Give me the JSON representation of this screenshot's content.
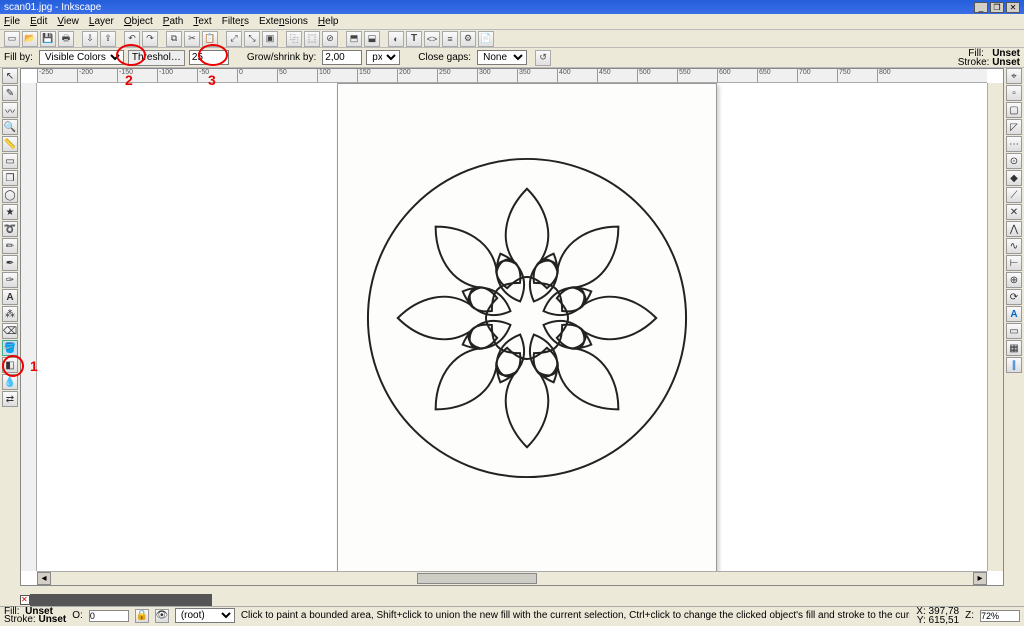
{
  "title": "scan01.jpg - Inkscape",
  "menu": {
    "file": "File",
    "edit": "Edit",
    "view": "View",
    "layer": "Layer",
    "object": "Object",
    "path": "Path",
    "text": "Text",
    "filters": "Filters",
    "extensions": "Extensions",
    "help": "Help"
  },
  "winbtns": {
    "min": "_",
    "max": "❐",
    "close": "✕"
  },
  "tooloptions": {
    "fillby_label": "Fill by:",
    "fillby_value": "Visible Colors",
    "threshold_label": "Threshol…",
    "threshold_value": "25",
    "growshrink_label": "Grow/shrink by:",
    "growshrink_value": "2,00",
    "unit": "px",
    "closegaps_label": "Close gaps:",
    "closegaps_value": "None"
  },
  "fillstroke": {
    "fill_lbl": "Fill:",
    "stroke_lbl": "Stroke:",
    "fill_val": "Unset",
    "stroke_val": "Unset"
  },
  "annotations": {
    "a1": "1",
    "a2": "2",
    "a3": "3"
  },
  "statusbar": {
    "fill_lbl": "Fill:",
    "stroke_lbl": "Stroke:",
    "fill_val": "Unset",
    "stroke_val": "Unset",
    "opacity_lbl": "O:",
    "opacity_val": "0",
    "layer": "(root)",
    "hint": "Click to paint a bounded area, Shift+click to union the new fill with the current selection, Ctrl+click to change the clicked object's fill and stroke to the current setting.",
    "x_lbl": "X:",
    "x_val": "397,78",
    "y_lbl": "Y:",
    "y_val": "615,51",
    "zoom_lbl": "Z:",
    "zoom_val": "72%"
  },
  "ruler": {
    "t0": "-250",
    "t1": "-200",
    "t2": "-150",
    "t3": "-100",
    "t4": "-50",
    "t5": "0",
    "t6": "50",
    "t7": "100",
    "t8": "150",
    "t9": "200",
    "t10": "250",
    "t11": "300",
    "t12": "350",
    "t13": "400",
    "t14": "450",
    "t15": "500",
    "t16": "550",
    "t17": "600",
    "t18": "650",
    "t19": "700",
    "t20": "750",
    "t21": "800"
  },
  "palette_colors": [
    "#000000",
    "#1a1a1a",
    "#333333",
    "#4d4d4d",
    "#666666",
    "#808080",
    "#999999",
    "#b3b3b3",
    "#cccccc",
    "#e6e6e6",
    "#ffffff",
    "#2a0000",
    "#550000",
    "#800000",
    "#aa0000",
    "#d40000",
    "#ff0000",
    "#ff2a2a",
    "#ff5555",
    "#ff8080",
    "#ffaaaa",
    "#ffd5d5",
    "#280b0b",
    "#501616",
    "#782121",
    "#a02c2c",
    "#c83737",
    "#d35f5f",
    "#de8787",
    "#e9afaf",
    "#f4d7d7",
    "#241c1c",
    "#483737",
    "#6c5353",
    "#916f6f",
    "#ac9393",
    "#c8b7b7",
    "#e3dbdb",
    "#2a1500",
    "#552a00",
    "#803f00",
    "#aa5500",
    "#d46a00",
    "#ff7f00",
    "#ff942a",
    "#ffaa55",
    "#ffbf80",
    "#ffd5aa",
    "#ffead5",
    "#28170b",
    "#502d16",
    "#784421",
    "#a05a2c",
    "#c87137",
    "#d38d5f",
    "#deaa87",
    "#e9c6af",
    "#f4e3d7",
    "#24201c",
    "#554000",
    "#806000",
    "#aa8000",
    "#d4a000",
    "#ffcc00",
    "#ffdd55",
    "#ffe680",
    "#fff0aa",
    "#fff6d5",
    "#2a2a00",
    "#555500",
    "#808000",
    "#aaaa00",
    "#d4d400",
    "#ffff00",
    "#425500",
    "#638000",
    "#84aa00",
    "#a6d400",
    "#c8ff00",
    "#152a00",
    "#2a5500",
    "#3f8000",
    "#55aa00",
    "#6ad400",
    "#80ff00",
    "#002a00",
    "#005500",
    "#008000",
    "#00aa00",
    "#00d400",
    "#00ff00"
  ]
}
